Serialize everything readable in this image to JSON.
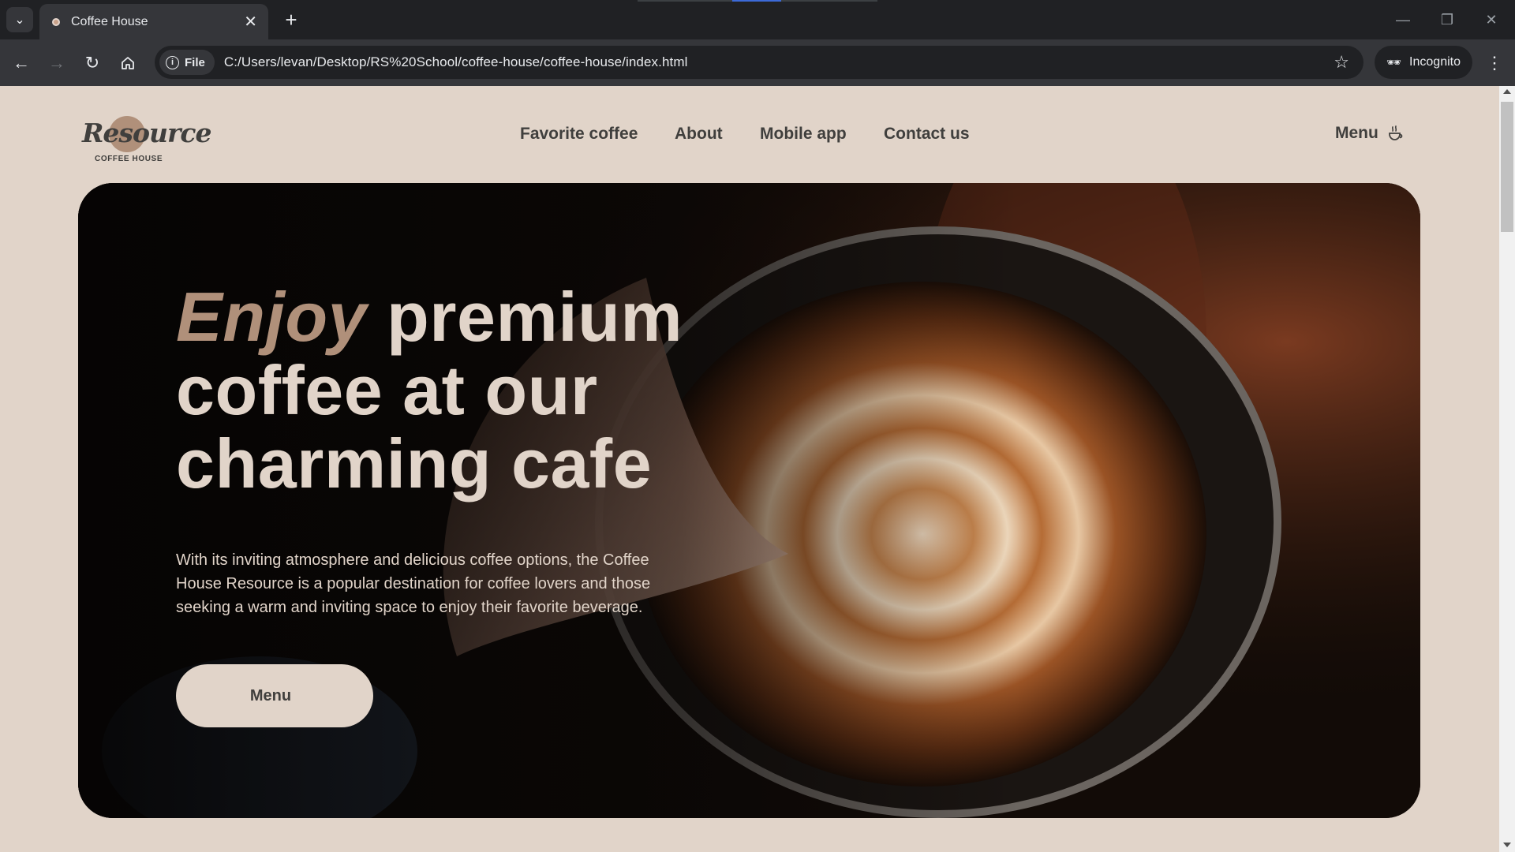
{
  "browser": {
    "tab_title": "Coffee House",
    "url_chip": "File",
    "url": "C:/Users/levan/Desktop/RS%20School/coffee-house/coffee-house/index.html",
    "profile_label": "Incognito"
  },
  "logo": {
    "word": "Resource",
    "subtitle": "COFFEE HOUSE"
  },
  "nav": {
    "items": [
      "Favorite coffee",
      "About",
      "Mobile app",
      "Contact us"
    ],
    "menu_label": "Menu"
  },
  "hero": {
    "title_accent": "Enjoy",
    "title_rest": " premium coffee at our charming cafe",
    "description": "With its inviting atmosphere and delicious coffee options, the Coffee House Resource is a popular destination for coffee lovers and those seeking a warm and inviting space to enjoy their favorite beverage.",
    "button_label": "Menu"
  },
  "colors": {
    "page_bg": "#e1d4c9",
    "text_dark": "#403f3d",
    "accent": "#b0907a"
  },
  "icons": [
    "chevron-down-icon",
    "close-icon",
    "plus-icon",
    "back-arrow-icon",
    "forward-arrow-icon",
    "reload-icon",
    "home-icon",
    "info-icon",
    "star-icon",
    "incognito-icon",
    "kebab-icon",
    "coffee-cup-icon",
    "minimize-icon",
    "restore-icon",
    "window-close-icon"
  ]
}
